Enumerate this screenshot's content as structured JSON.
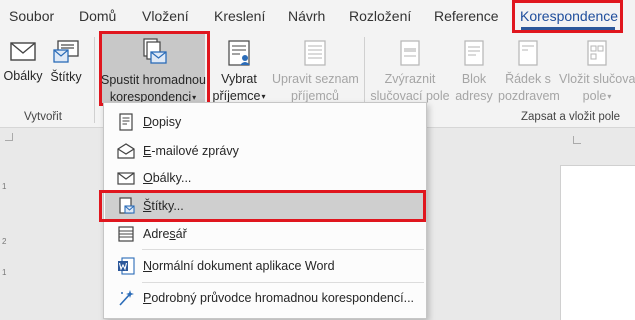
{
  "tabs": [
    {
      "label": "Soubor"
    },
    {
      "label": "Domů"
    },
    {
      "label": "Vložení"
    },
    {
      "label": "Kreslení"
    },
    {
      "label": "Návrh"
    },
    {
      "label": "Rozložení"
    },
    {
      "label": "Reference"
    },
    {
      "label": "Korespondence",
      "active": true
    }
  ],
  "ribbon": {
    "create_group": {
      "label": "Vytvořit",
      "envelopes": "Obálky",
      "labels": "Štítky"
    },
    "start_merge": {
      "line1": "Spustit hromadnou",
      "line2": "korespondenci"
    },
    "select_recipients": {
      "line1": "Vybrat",
      "line2": "příjemce"
    },
    "edit_list": {
      "line1": "Upravit seznam",
      "line2": "příjemců"
    },
    "write_group": {
      "label": "Zapsat a vložit pole",
      "highlight": {
        "line1": "Zvýraznit",
        "line2": "slučovací pole"
      },
      "address_block": {
        "line1": "Blok",
        "line2": "adresy"
      },
      "greeting": {
        "line1": "Řádek s",
        "line2": "pozdravem"
      },
      "insert_field": {
        "line1": "Vložit slučovací",
        "line2": "pole"
      }
    }
  },
  "menu": {
    "items": [
      {
        "pre": "",
        "u": "D",
        "post": "opisy",
        "icon": "letter-icon"
      },
      {
        "pre": "",
        "u": "E",
        "post": "-mailové zprávy",
        "icon": "envelope-open-icon"
      },
      {
        "pre": "",
        "u": "O",
        "post": "bálky...",
        "icon": "envelope-icon"
      },
      {
        "pre": "",
        "u": "Š",
        "post": "títky...",
        "icon": "labels-icon"
      },
      {
        "pre": "Adre",
        "u": "s",
        "post": "ář",
        "icon": "directory-icon"
      },
      {
        "pre": "",
        "u": "N",
        "post": "ormální dokument aplikace Word",
        "icon": "word-icon"
      },
      {
        "pre": "",
        "u": "P",
        "post": "odrobný průvodce hromadnou korespondencí...",
        "icon": "wizard-icon"
      }
    ]
  },
  "ruler": {
    "marks": [
      "1",
      "2",
      "1"
    ]
  },
  "colors": {
    "highlight": "#e0161e",
    "accent": "#2b579a"
  }
}
